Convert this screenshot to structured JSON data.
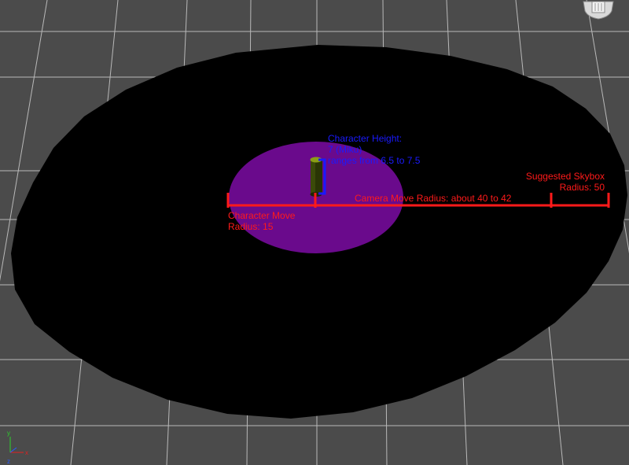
{
  "viewport": {
    "background": "#4b4b4b",
    "grid_color": "#b9b9b9",
    "skybox_fill": "#000000",
    "move_area_fill": "#6a0a8c",
    "annotation_red": "#ff1a1a",
    "annotation_blue": "#1a1aff"
  },
  "annotations": {
    "character_height": {
      "line1": "Character Height:",
      "line2": "7 (Miku)",
      "line3": "ranges from 6.5 to 7.5"
    },
    "character_move": {
      "line1": "Character Move",
      "line2": "Radius: 15"
    },
    "camera_move": "Camera Move Radius: about 40 to 42",
    "skybox": {
      "line1": "Suggested Skybox",
      "line2": "Radius: 50"
    }
  },
  "icons": {
    "nav_cube": "viewcube-icon",
    "axis_gizmo": "axis-tripod-icon"
  }
}
